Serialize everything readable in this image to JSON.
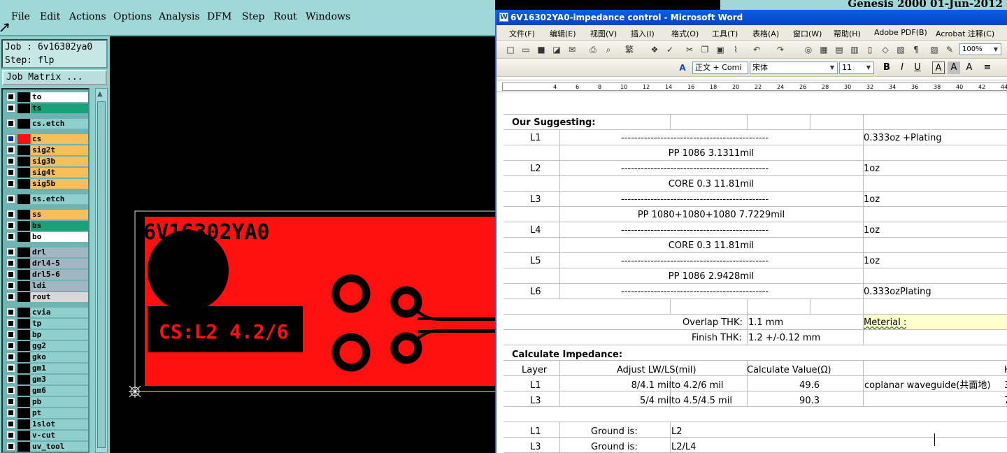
{
  "genesis": {
    "menu": [
      "File",
      "Edit",
      "Actions",
      "Options",
      "Analysis",
      "DFM",
      "Step",
      "Rout",
      "Windows"
    ],
    "job_line": "Job : 6v16302ya0",
    "step_line": "Step: flp",
    "matrix_button": "Job Matrix ...",
    "header_text": "Genesis 2000 01-Jun-2012",
    "layers": [
      {
        "name": "to",
        "color": "#ffffff"
      },
      {
        "name": "ts",
        "color": "#1aa179"
      },
      {
        "name": "cs.etch",
        "color": "#8fcfcd"
      },
      {
        "name": "cs",
        "color": "#f5c05a",
        "active": true
      },
      {
        "name": "sig2t",
        "color": "#f5c05a"
      },
      {
        "name": "sig3b",
        "color": "#f5c05a"
      },
      {
        "name": "sig4t",
        "color": "#f5c05a"
      },
      {
        "name": "sig5b",
        "color": "#f5c05a"
      },
      {
        "name": "ss.etch",
        "color": "#8fcfcd"
      },
      {
        "name": "ss",
        "color": "#f5c05a"
      },
      {
        "name": "bs",
        "color": "#1aa179"
      },
      {
        "name": "bo",
        "color": "#ffffff"
      },
      {
        "name": "drl",
        "color": "#a0b7c2"
      },
      {
        "name": "drl4-5",
        "color": "#a0b7c2"
      },
      {
        "name": "drl5-6",
        "color": "#a0b7c2"
      },
      {
        "name": "ldi",
        "color": "#a0b7c2"
      },
      {
        "name": "rout",
        "color": "#d8d8d8"
      },
      {
        "name": "cvia",
        "color": "#8fcfcd"
      },
      {
        "name": "tp",
        "color": "#8fcfcd"
      },
      {
        "name": "bp",
        "color": "#8fcfcd"
      },
      {
        "name": "gg2",
        "color": "#8fcfcd"
      },
      {
        "name": "gko",
        "color": "#8fcfcd"
      },
      {
        "name": "gm1",
        "color": "#8fcfcd"
      },
      {
        "name": "gm3",
        "color": "#8fcfcd"
      },
      {
        "name": "gm6",
        "color": "#8fcfcd"
      },
      {
        "name": "pb",
        "color": "#8fcfcd"
      },
      {
        "name": "pt",
        "color": "#8fcfcd"
      },
      {
        "name": "1slot",
        "color": "#8fcfcd"
      },
      {
        "name": "v-cut",
        "color": "#8fcfcd"
      },
      {
        "name": "uv_tool",
        "color": "#8fcfcd"
      }
    ],
    "board_text": "6V16302YA0",
    "board_label": "CS:L2 4.2/6",
    "board_color": "#ff1010"
  },
  "word": {
    "title": "6V16302YA0-impedance control - Microsoft Word",
    "menu": [
      "文件(F)",
      "编辑(E)",
      "视图(V)",
      "插入(I)",
      "格式(O)",
      "工具(T)",
      "表格(A)",
      "窗口(W)",
      "帮助(H)",
      "Adobe PDF(B)",
      "Acrobat 注释(C)"
    ],
    "zoom": "100%",
    "style": "正文 + Comi",
    "font": "宋体",
    "size": "11",
    "ruler_ticks": [
      "4",
      "6",
      "8",
      "10",
      "12",
      "14",
      "16",
      "18",
      "20",
      "22",
      "24",
      "26",
      "28",
      "30",
      "32",
      "34",
      "36",
      "38",
      "40",
      "42",
      "44"
    ],
    "suggest_heading": "Our Suggesting:",
    "stack": [
      {
        "layer": "L1",
        "dash": "---------------------------------------------",
        "copper": "0.333oz +Plating"
      },
      {
        "mid": "PP  1086  3.1311mil"
      },
      {
        "layer": "L2",
        "dash": "---------------------------------------------",
        "copper": "1oz"
      },
      {
        "mid": "CORE  0.3  11.81mil"
      },
      {
        "layer": "L3",
        "dash": "---------------------------------------------",
        "copper": "1oz"
      },
      {
        "mid": "PP  1080+1080+1080  7.7229mil"
      },
      {
        "layer": "L4",
        "dash": "---------------------------------------------",
        "copper": "1oz"
      },
      {
        "mid": "CORE  0.3  11.81mil"
      },
      {
        "layer": "L5",
        "dash": "---------------------------------------------",
        "copper": "1oz"
      },
      {
        "mid": "PP  1086  2.9428mil"
      },
      {
        "layer": "L6",
        "dash": "---------------------------------------------",
        "copper": "0.333ozPlating"
      }
    ],
    "overlap_label": "Overlap THK:",
    "overlap_value": "1.1 mm",
    "material_label": "Meterial :",
    "finish_label": "Finish THK:",
    "finish_value": "1.2 +/-0.12 mm",
    "calc_heading": "Calculate Impedance:",
    "calc_headers": [
      "Layer",
      "Adjust LW/LS(mil)",
      "Calculate Value(Ω)",
      "H"
    ],
    "calc_rows": [
      {
        "layer": "L1",
        "from": "8/4.1 mil",
        "to": "to  4.2/6 mil",
        "value": "49.6",
        "type": "coplanar waveguide(共面地)",
        "extra": "3"
      },
      {
        "layer": "L3",
        "from": "5/4 mil",
        "to": "to  4.5/4.5 mil",
        "value": "90.3",
        "type": "",
        "extra": "7"
      }
    ],
    "ground_rows": [
      {
        "layer": "L1",
        "label": "Ground is:",
        "value": "L2"
      },
      {
        "layer": "L3",
        "label": "Ground is:",
        "value": "L2/L4"
      }
    ]
  }
}
